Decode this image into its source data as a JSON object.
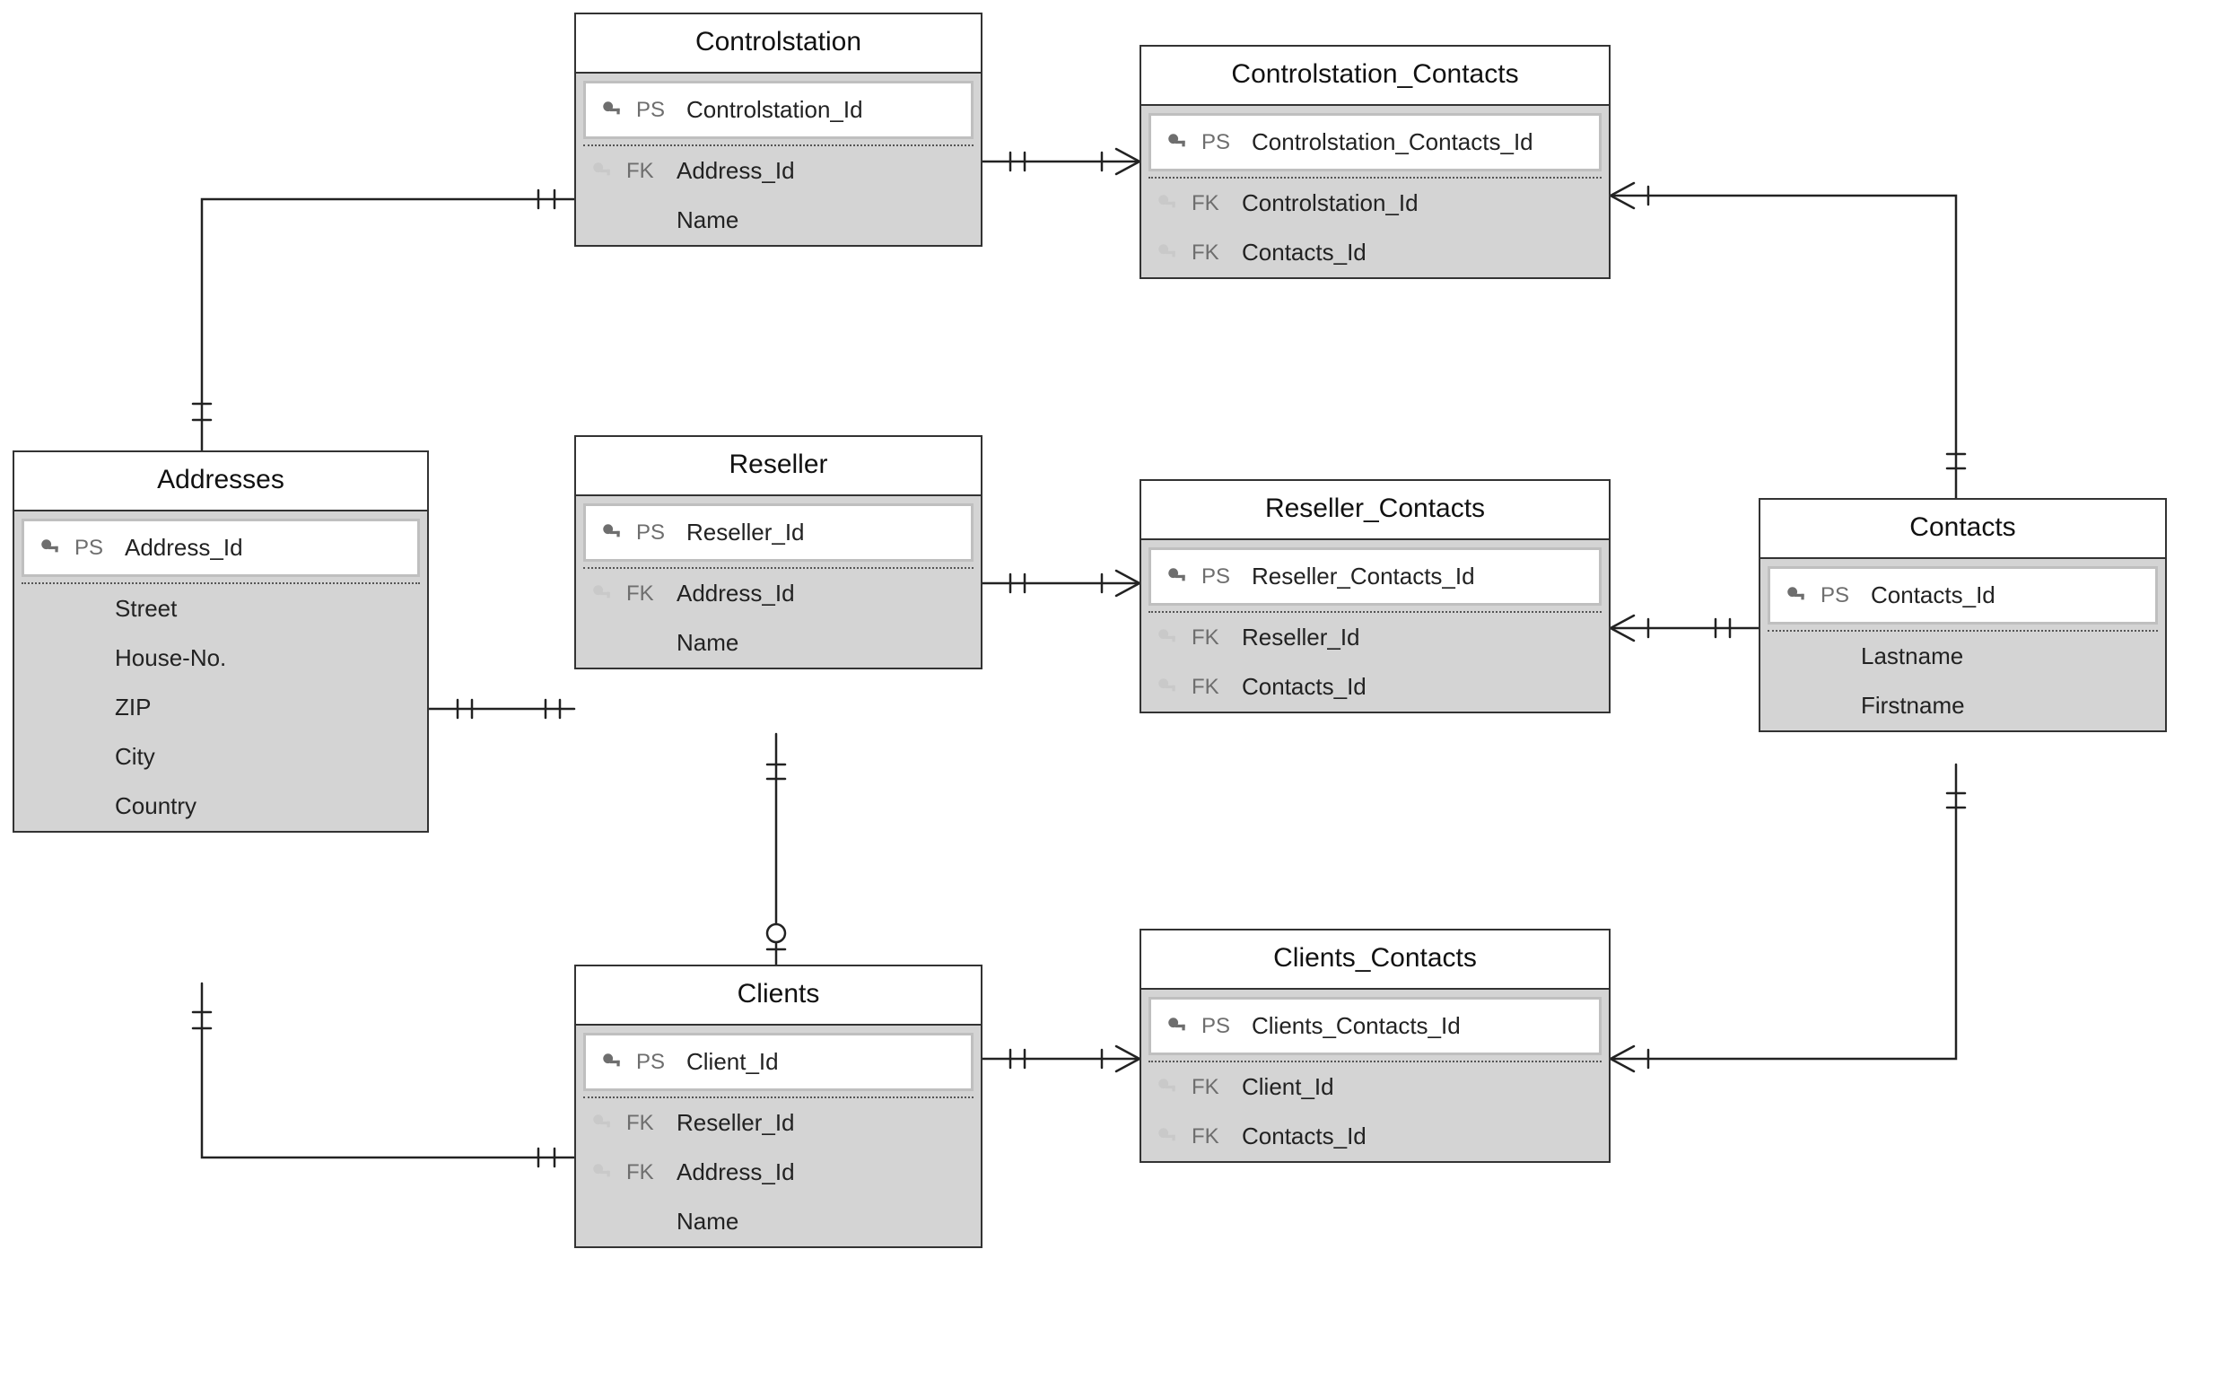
{
  "labels": {
    "ps": "PS",
    "fk": "FK"
  },
  "entities": {
    "controlstation": {
      "title": "Controlstation",
      "pk": "Controlstation_Id",
      "attrs": [
        {
          "tag": "FK",
          "name": "Address_Id"
        },
        {
          "tag": "",
          "name": "Name"
        }
      ]
    },
    "controlstation_contacts": {
      "title": "Controlstation_Contacts",
      "pk": "Controlstation_Contacts_Id",
      "attrs": [
        {
          "tag": "FK",
          "name": "Controlstation_Id"
        },
        {
          "tag": "FK",
          "name": "Contacts_Id"
        }
      ]
    },
    "addresses": {
      "title": "Addresses",
      "pk": "Address_Id",
      "attrs": [
        {
          "tag": "",
          "name": "Street"
        },
        {
          "tag": "",
          "name": "House-No."
        },
        {
          "tag": "",
          "name": "ZIP"
        },
        {
          "tag": "",
          "name": "City"
        },
        {
          "tag": "",
          "name": "Country"
        }
      ]
    },
    "reseller": {
      "title": "Reseller",
      "pk": "Reseller_Id",
      "attrs": [
        {
          "tag": "FK",
          "name": "Address_Id"
        },
        {
          "tag": "",
          "name": "Name"
        }
      ]
    },
    "reseller_contacts": {
      "title": "Reseller_Contacts",
      "pk": "Reseller_Contacts_Id",
      "attrs": [
        {
          "tag": "FK",
          "name": "Reseller_Id"
        },
        {
          "tag": "FK",
          "name": "Contacts_Id"
        }
      ]
    },
    "contacts": {
      "title": "Contacts",
      "pk": "Contacts_Id",
      "attrs": [
        {
          "tag": "",
          "name": "Lastname"
        },
        {
          "tag": "",
          "name": "Firstname"
        }
      ]
    },
    "clients": {
      "title": "Clients",
      "pk": "Client_Id",
      "attrs": [
        {
          "tag": "FK",
          "name": "Reseller_Id"
        },
        {
          "tag": "FK",
          "name": "Address_Id"
        },
        {
          "tag": "",
          "name": "Name"
        }
      ]
    },
    "clients_contacts": {
      "title": "Clients_Contacts",
      "pk": "Clients_Contacts_Id",
      "attrs": [
        {
          "tag": "FK",
          "name": "Client_Id"
        },
        {
          "tag": "FK",
          "name": "Contacts_Id"
        }
      ]
    }
  }
}
